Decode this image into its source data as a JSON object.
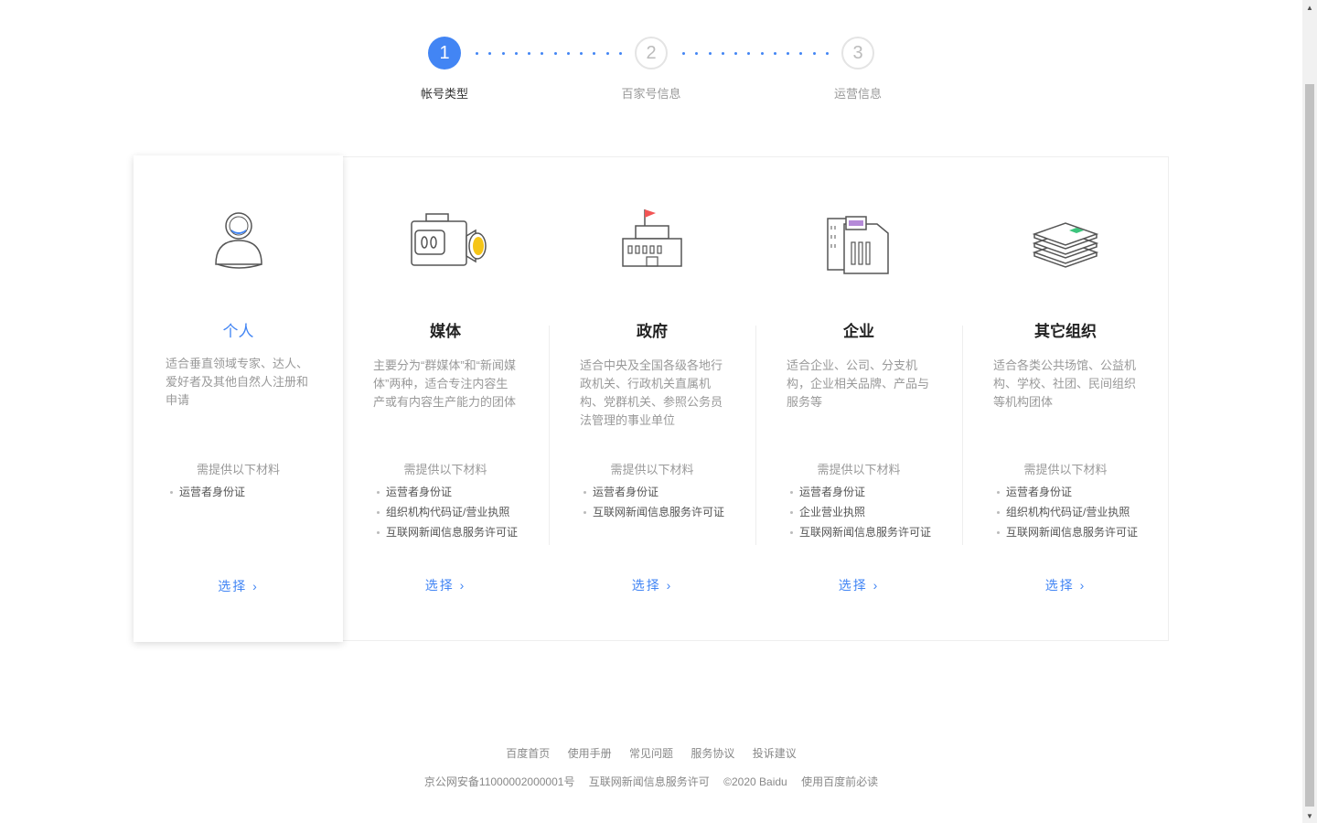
{
  "steps": [
    {
      "number": "1",
      "label": "帐号类型"
    },
    {
      "number": "2",
      "label": "百家号信息"
    },
    {
      "number": "3",
      "label": "运营信息"
    }
  ],
  "cards": [
    {
      "title": "个人",
      "icon": "person-icon",
      "desc": "适合垂直领域专家、达人、爱好者及其他自然人注册和申请",
      "req_title": "需提供以下材料",
      "reqs": [
        "运营者身份证"
      ],
      "select": "选择 ›"
    },
    {
      "title": "媒体",
      "icon": "camera-icon",
      "desc": "主要分为“群媒体”和“新闻媒体”两种，适合专注内容生产或有内容生产能力的团体",
      "req_title": "需提供以下材料",
      "reqs": [
        "运营者身份证",
        "组织机构代码证/营业执照",
        "互联网新闻信息服务许可证"
      ],
      "select": "选择 ›"
    },
    {
      "title": "政府",
      "icon": "government-building-icon",
      "desc": "适合中央及全国各级各地行政机关、行政机关直属机构、党群机关、参照公务员法管理的事业单位",
      "req_title": "需提供以下材料",
      "reqs": [
        "运营者身份证",
        "互联网新闻信息服务许可证"
      ],
      "select": "选择 ›"
    },
    {
      "title": "企业",
      "icon": "office-building-icon",
      "desc": "适合企业、公司、分支机构，企业相关品牌、产品与服务等",
      "req_title": "需提供以下材料",
      "reqs": [
        "运营者身份证",
        "企业营业执照",
        "互联网新闻信息服务许可证"
      ],
      "select": "选择 ›"
    },
    {
      "title": "其它组织",
      "icon": "layers-icon",
      "desc": "适合各类公共场馆、公益机构、学校、社团、民间组织等机构团体",
      "req_title": "需提供以下材料",
      "reqs": [
        "运营者身份证",
        "组织机构代码证/营业执照",
        "互联网新闻信息服务许可证"
      ],
      "select": "选择 ›"
    }
  ],
  "footer": {
    "links": [
      "百度首页",
      "使用手册",
      "常见问题",
      "服务协议",
      "投诉建议"
    ],
    "icp": "京公网安备11000002000001号",
    "license": "互联网新闻信息服务许可",
    "copyright": "©2020 Baidu",
    "must_read": "使用百度前必读"
  },
  "colors": {
    "accent": "#4285f4",
    "flag": "#f25454",
    "camera_lens": "#f5c518",
    "screen": "#b58ad8",
    "green": "#3cc47c"
  }
}
